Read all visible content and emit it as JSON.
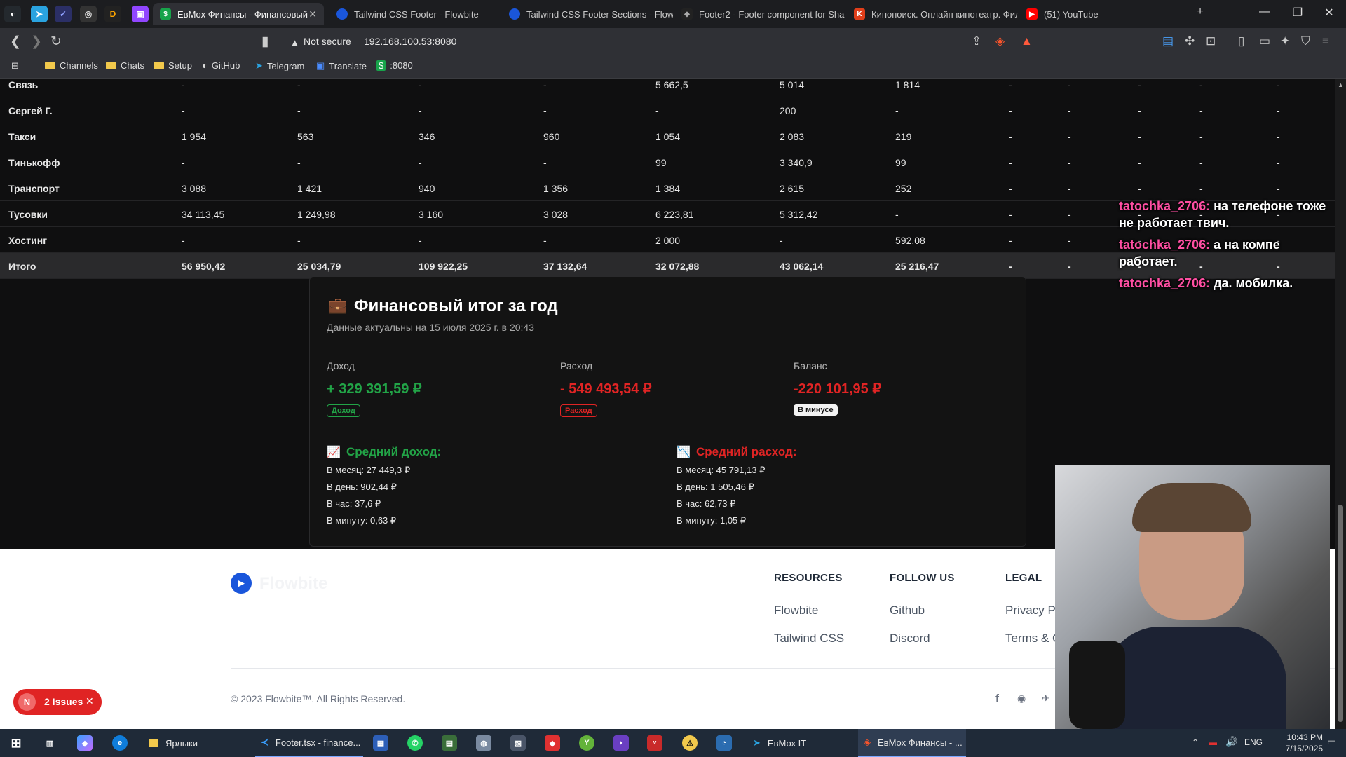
{
  "browser": {
    "tabs": [
      {
        "title": "ЕвМох Финансы - Финансовый",
        "active": true
      },
      {
        "title": "Tailwind CSS Footer - Flowbite",
        "active": false
      },
      {
        "title": "Tailwind CSS Footer Sections - Flowb",
        "active": false
      },
      {
        "title": "Footer2 - Footer component for Sha",
        "active": false
      },
      {
        "title": "Кинопоиск. Онлайн кинотеатр. Фил",
        "active": false
      },
      {
        "title": "(51) YouTube",
        "active": false
      }
    ],
    "pinned_tab_icons": [
      "github-icon",
      "telegram-icon",
      "app-icon",
      "app-icon",
      "d-icon",
      "twitch-icon"
    ],
    "not_secure_label": "Not secure",
    "url": "192.168.100.53:8080",
    "bookmarks": [
      {
        "label": "Channels",
        "icon": "folder-icon"
      },
      {
        "label": "Chats",
        "icon": "folder-icon"
      },
      {
        "label": "Setup",
        "icon": "folder-icon"
      },
      {
        "label": "GitHub",
        "icon": "github-icon"
      },
      {
        "label": "Telegram",
        "icon": "telegram-icon"
      },
      {
        "label": "Translate",
        "icon": "translate-icon"
      },
      {
        "label": ":8080",
        "icon": "dollar-icon"
      }
    ]
  },
  "table": {
    "rows": [
      {
        "name": "Связь",
        "values": [
          "-",
          "-",
          "-",
          "-",
          "5 662,5",
          "5 014",
          "1 814",
          "-",
          "-",
          "-",
          "-",
          "-"
        ]
      },
      {
        "name": "Сергей Г.",
        "values": [
          "-",
          "-",
          "-",
          "-",
          "-",
          "200",
          "-",
          "-",
          "-",
          "-",
          "-",
          "-"
        ]
      },
      {
        "name": "Такси",
        "values": [
          "1 954",
          "563",
          "346",
          "960",
          "1 054",
          "2 083",
          "219",
          "-",
          "-",
          "-",
          "-",
          "-"
        ]
      },
      {
        "name": "Тинькофф",
        "values": [
          "-",
          "-",
          "-",
          "-",
          "99",
          "3 340,9",
          "99",
          "-",
          "-",
          "-",
          "-",
          "-"
        ]
      },
      {
        "name": "Транспорт",
        "values": [
          "3 088",
          "1 421",
          "940",
          "1 356",
          "1 384",
          "2 615",
          "252",
          "-",
          "-",
          "-",
          "-",
          "-"
        ]
      },
      {
        "name": "Тусовки",
        "values": [
          "34 113,45",
          "1 249,98",
          "3 160",
          "3 028",
          "6 223,81",
          "5 312,42",
          "-",
          "-",
          "-",
          "-",
          "-",
          "-"
        ]
      },
      {
        "name": "Хостинг",
        "values": [
          "-",
          "-",
          "-",
          "-",
          "2 000",
          "-",
          "592,08",
          "-",
          "-",
          "-",
          "-",
          "-"
        ]
      }
    ],
    "total": {
      "name": "Итого",
      "values": [
        "56 950,42",
        "25 034,79",
        "109 922,25",
        "37 132,64",
        "32 072,88",
        "43 062,14",
        "25 216,47",
        "-",
        "-",
        "-",
        "-",
        "-"
      ]
    }
  },
  "summary": {
    "emoji": "💼",
    "title": "Финансовый итог за год",
    "subtitle": "Данные актуальны на 15 июля 2025 г. в 20:43",
    "income": {
      "label": "Доход",
      "value": "+ 329 391,59 ₽",
      "badge": "Доход",
      "color": "#22a447"
    },
    "expense": {
      "label": "Расход",
      "value": "- 549 493,54 ₽",
      "badge": "Расход",
      "color": "#e02424"
    },
    "balance": {
      "label": "Баланс",
      "value": "-220 101,95 ₽",
      "badge": "В минусе",
      "color": "#e02424"
    },
    "avg_income": {
      "title": "Средний доход:",
      "lines": [
        "В месяц: 27 449,3 ₽",
        "В день: 902,44 ₽",
        "В час: 37,6 ₽",
        "В минуту: 0,63 ₽"
      ]
    },
    "avg_expense": {
      "title": "Средний расход:",
      "lines": [
        "В месяц: 45 791,13 ₽",
        "В день: 1 505,46 ₽",
        "В час: 62,73 ₽",
        "В минуту: 1,05 ₽"
      ]
    }
  },
  "footer": {
    "brand": "Flowbite",
    "columns": [
      {
        "heading": "RESOURCES",
        "links": [
          "Flowbite",
          "Tailwind CSS"
        ]
      },
      {
        "heading": "FOLLOW US",
        "links": [
          "Github",
          "Discord"
        ]
      },
      {
        "heading": "LEGAL",
        "links": [
          "Privacy Po",
          "Terms & C"
        ]
      }
    ],
    "copyright": "© 2023 Flowbite™. All Rights Reserved."
  },
  "chat": [
    {
      "user": "tatochka_2706:",
      "text": "на телефоне тоже не работает твич."
    },
    {
      "user": "tatochka_2706:",
      "text": "а на компе работает."
    },
    {
      "user": "tatochka_2706:",
      "text": "да. мобилка."
    }
  ],
  "issues_badge": {
    "letter": "N",
    "label": "2 Issues"
  },
  "taskbar": {
    "apps": [
      {
        "label": "Ярлыки"
      },
      {
        "label": "Footer.tsx - finance..."
      },
      {
        "label": "ЕвМох IT"
      },
      {
        "label": "ЕвМох Финансы - ..."
      }
    ],
    "lang": "ENG",
    "time": "10:43 PM",
    "date": "7/15/2025"
  }
}
